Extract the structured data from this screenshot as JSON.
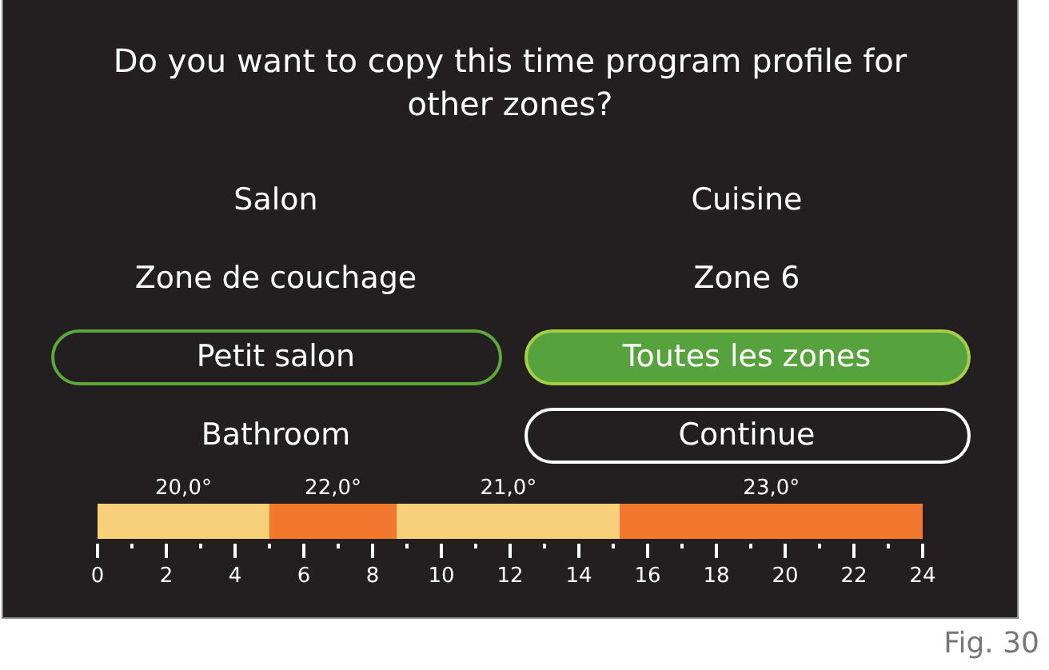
{
  "screen": {
    "question": "Do you want to copy this time program profile for other zones?",
    "options": [
      {
        "label": "Salon",
        "kind": "zone",
        "selected": false
      },
      {
        "label": "Cuisine",
        "kind": "zone",
        "selected": false
      },
      {
        "label": "Zone de couchage",
        "kind": "zone",
        "selected": false
      },
      {
        "label": "Zone 6",
        "kind": "zone",
        "selected": false
      },
      {
        "label": "Petit salon",
        "kind": "zone",
        "selected": true
      },
      {
        "label": "Toutes les zones",
        "kind": "all",
        "selected": true
      },
      {
        "label": "Bathroom",
        "kind": "zone",
        "selected": false
      }
    ],
    "continue_button": {
      "label": "Continue"
    },
    "schedule": {
      "chart_data": {
        "type": "bar",
        "orientation": "horizontal",
        "stacked": true,
        "xlim": [
          0,
          24
        ],
        "xticks": [
          0,
          2,
          4,
          6,
          8,
          10,
          12,
          14,
          16,
          18,
          20,
          22,
          24
        ],
        "series": [
          {
            "name": "20,0°",
            "color": "#f9d07a",
            "values": [
              5
            ]
          },
          {
            "name": "22,0°",
            "color": "#f1782d",
            "values": [
              3.7
            ]
          },
          {
            "name": "21,0°",
            "color": "#f9d07a",
            "values": [
              6.5
            ]
          },
          {
            "name": "23,0°",
            "color": "#f1782d",
            "values": [
              8.8
            ]
          }
        ]
      }
    }
  },
  "caption": "Fig. 30"
}
